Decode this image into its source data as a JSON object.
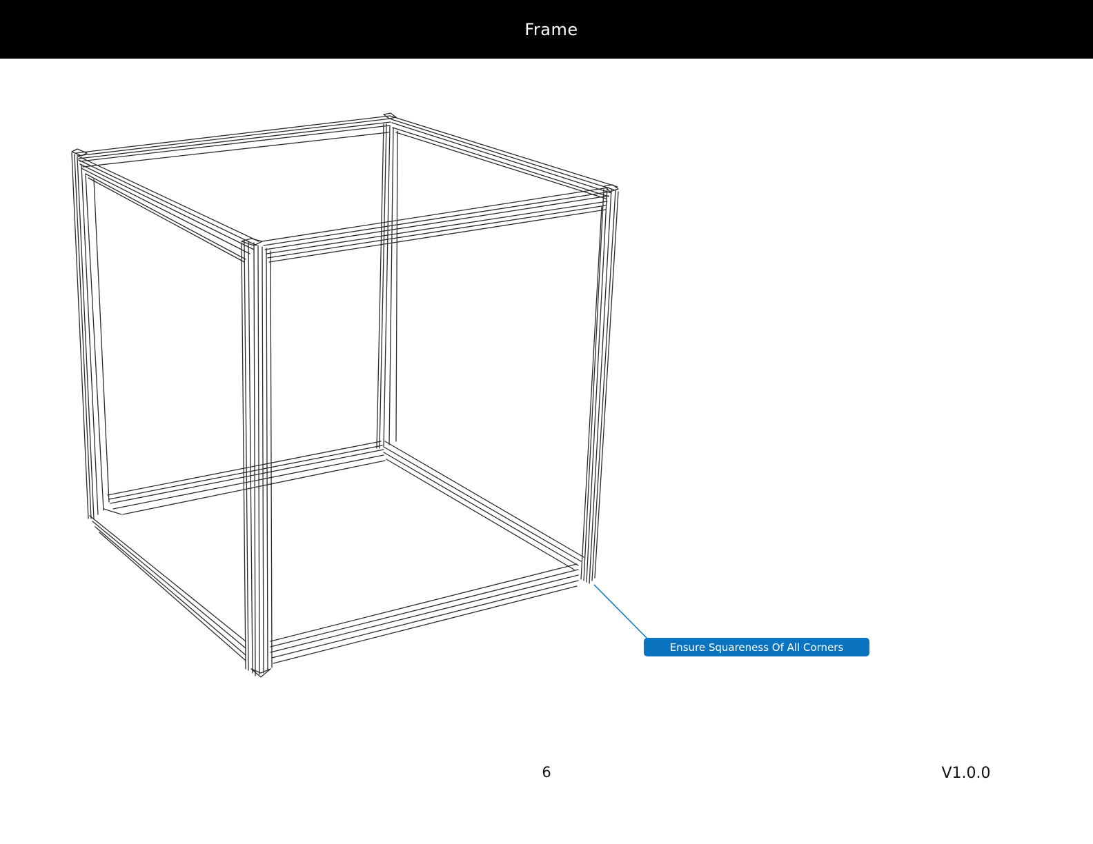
{
  "header": {
    "title": "Frame",
    "background_color": "#000000",
    "text_color": "#ffffff"
  },
  "illustration": {
    "subject": "aluminum-extrusion-cube-frame",
    "style": "line-drawing",
    "line_color": "#2a2a2a"
  },
  "callout": {
    "text": "Ensure Squareness Of All Corners",
    "color": "#0a74c1",
    "text_color": "#ffffff"
  },
  "footer": {
    "page_number": "6",
    "version": "V1.0.0"
  }
}
